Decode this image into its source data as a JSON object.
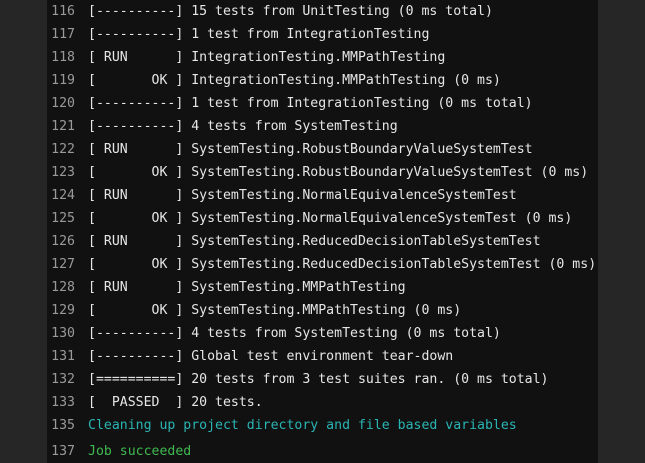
{
  "log": {
    "lines": [
      {
        "num": "116",
        "text": "[----------] 15 tests from UnitTesting (0 ms total)"
      },
      {
        "num": "117",
        "text": "[----------] 1 test from IntegrationTesting"
      },
      {
        "num": "118",
        "text": "[ RUN      ] IntegrationTesting.MMPathTesting"
      },
      {
        "num": "119",
        "text": "[       OK ] IntegrationTesting.MMPathTesting (0 ms)"
      },
      {
        "num": "120",
        "text": "[----------] 1 test from IntegrationTesting (0 ms total)"
      },
      {
        "num": "121",
        "text": "[----------] 4 tests from SystemTesting"
      },
      {
        "num": "122",
        "text": "[ RUN      ] SystemTesting.RobustBoundaryValueSystemTest"
      },
      {
        "num": "123",
        "text": "[       OK ] SystemTesting.RobustBoundaryValueSystemTest (0 ms)"
      },
      {
        "num": "124",
        "text": "[ RUN      ] SystemTesting.NormalEquivalenceSystemTest"
      },
      {
        "num": "125",
        "text": "[       OK ] SystemTesting.NormalEquivalenceSystemTest (0 ms)"
      },
      {
        "num": "126",
        "text": "[ RUN      ] SystemTesting.ReducedDecisionTableSystemTest"
      },
      {
        "num": "127",
        "text": "[       OK ] SystemTesting.ReducedDecisionTableSystemTest (0 ms)"
      },
      {
        "num": "128",
        "text": "[ RUN      ] SystemTesting.MMPathTesting"
      },
      {
        "num": "129",
        "text": "[       OK ] SystemTesting.MMPathTesting (0 ms)"
      },
      {
        "num": "130",
        "text": "[----------] 4 tests from SystemTesting (0 ms total)"
      },
      {
        "num": "131",
        "text": "[----------] Global test environment tear-down"
      },
      {
        "num": "132",
        "text": "[==========] 20 tests from 3 test suites ran. (0 ms total)"
      },
      {
        "num": "133",
        "text": "[  PASSED  ] 20 tests."
      },
      {
        "num": "135",
        "text": "Cleaning up project directory and file based variables"
      },
      {
        "num": "137",
        "text": "Job succeeded"
      }
    ]
  },
  "colors": {
    "background": "#111111",
    "text": "#e6e6e6",
    "line_number": "#9a9a9a",
    "section_header": "#2bb4b4",
    "success": "#3fb950"
  }
}
